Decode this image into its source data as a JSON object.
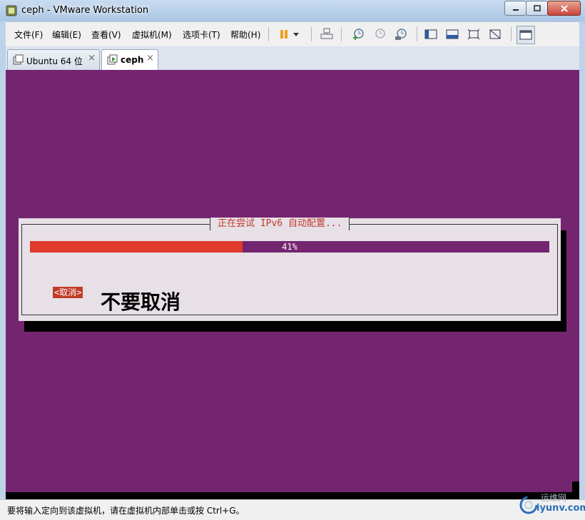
{
  "window": {
    "title": "ceph - VMware Workstation"
  },
  "menu": [
    "文件(F)",
    "编辑(E)",
    "查看(V)",
    "虚拟机(M)",
    "选项卡(T)",
    "帮助(H)"
  ],
  "tabs": [
    {
      "label": "Ubuntu 64 位",
      "close": "×"
    },
    {
      "label": "ceph",
      "close": "×"
    }
  ],
  "dialog": {
    "title": "正在尝试 IPv6 自动配置...",
    "progress_percent": 41,
    "progress_label": "41%",
    "cancel_label": "<取消>",
    "annotation": "不要取消"
  },
  "colors": {
    "guest_background": "#742570",
    "progress_fill": "#e03a2a",
    "dialog_background": "#e7e0e6"
  },
  "status": {
    "text": "要将输入定向到该虚拟机，请在虚拟机内部单击或按 Ctrl+G。"
  },
  "watermark": {
    "text": "运维网",
    "site": "iyunv.com"
  }
}
